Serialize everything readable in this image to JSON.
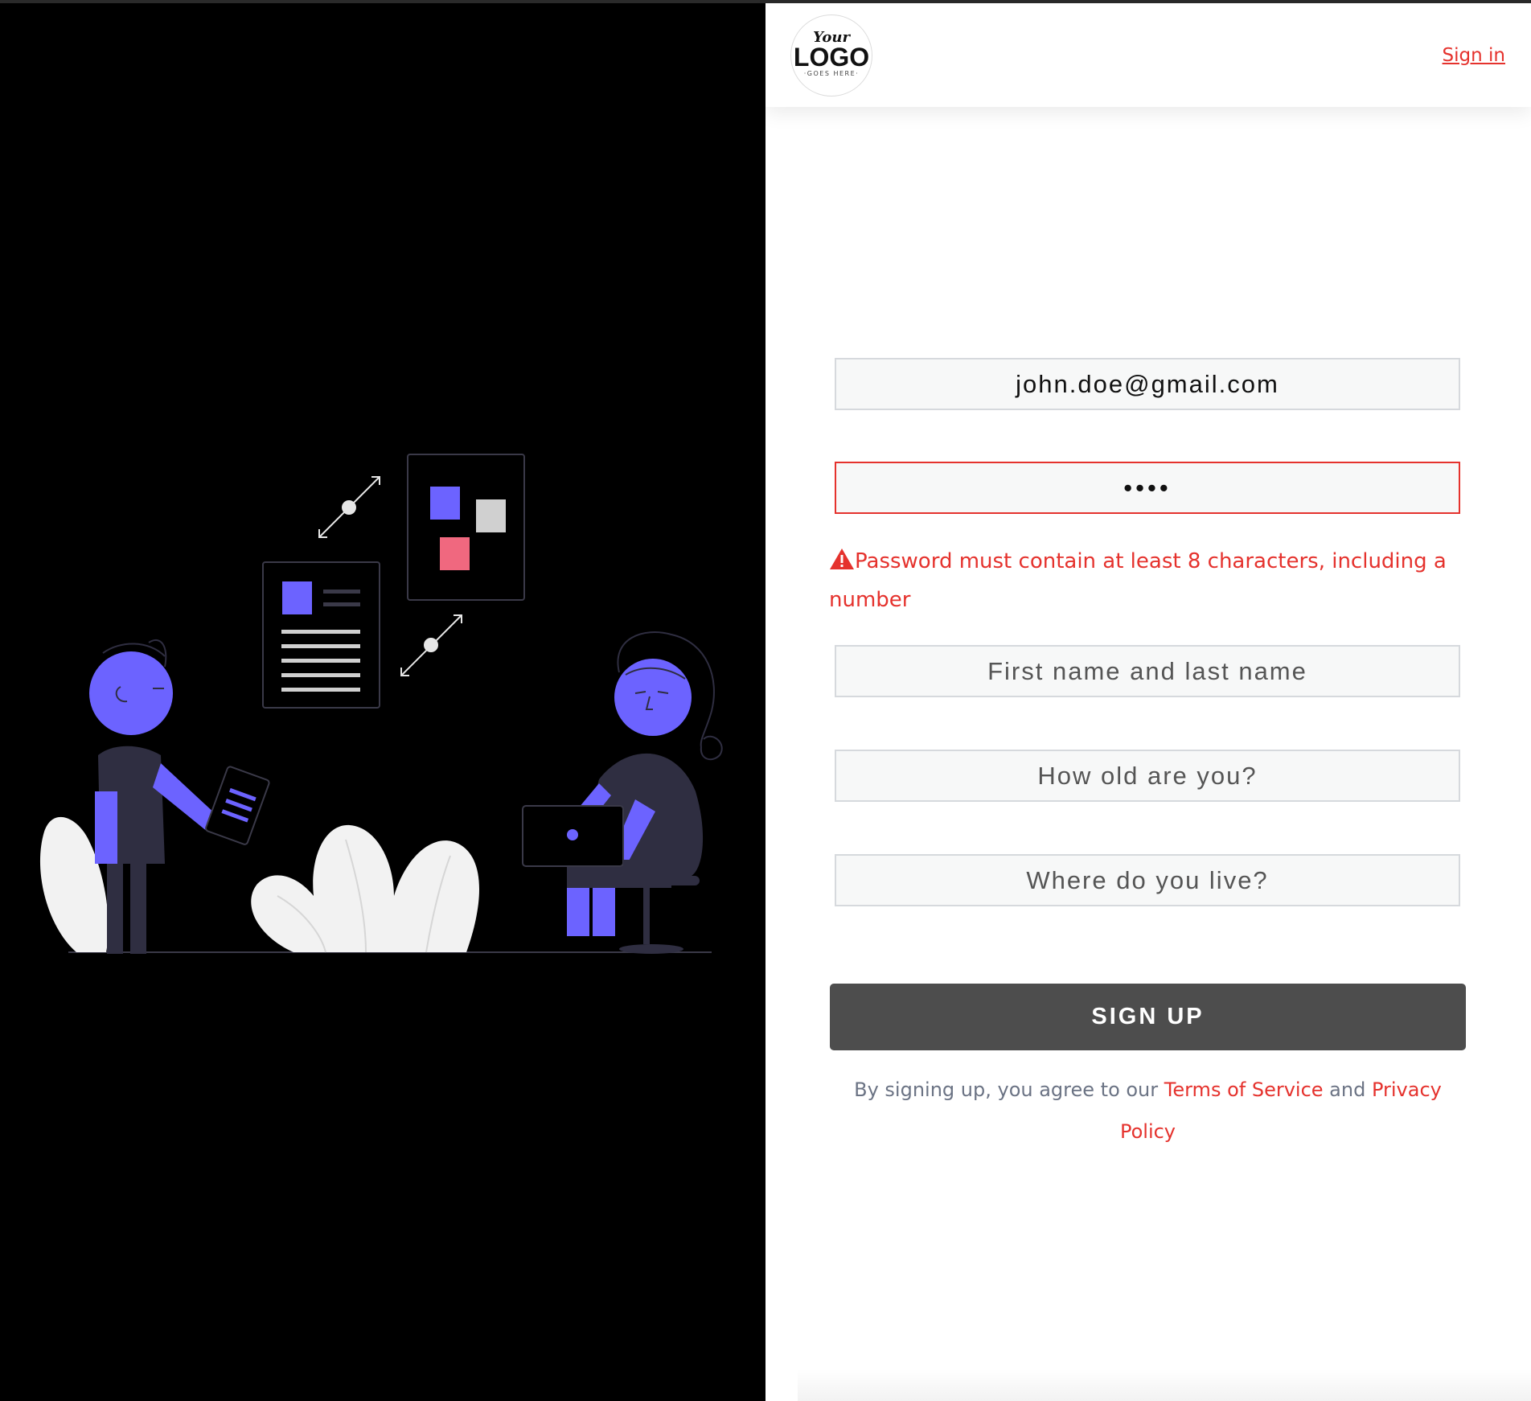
{
  "header": {
    "logo": {
      "line1": "Your",
      "line2": "LOGO",
      "line3": "·GOES HERE·"
    },
    "signin_label": "Sign in"
  },
  "form": {
    "email_value": "john.doe@gmail.com",
    "password_value": "••••",
    "password_error": "Password must contain at least 8 characters, including a number",
    "name_placeholder": "First name and last name",
    "age_placeholder": "How old are you?",
    "location_placeholder": "Where do you live?",
    "submit_label": "SIGN UP"
  },
  "terms": {
    "prefix": "By signing up, you agree to our ",
    "tos": "Terms of Service",
    "and": " and ",
    "privacy": "Privacy Policy"
  },
  "colors": {
    "accent": "#e5322d",
    "illustration_primary": "#6c63ff",
    "illustration_dark": "#2f2e41",
    "illustration_pink": "#f0687f"
  },
  "icons": [
    "warning-icon"
  ]
}
